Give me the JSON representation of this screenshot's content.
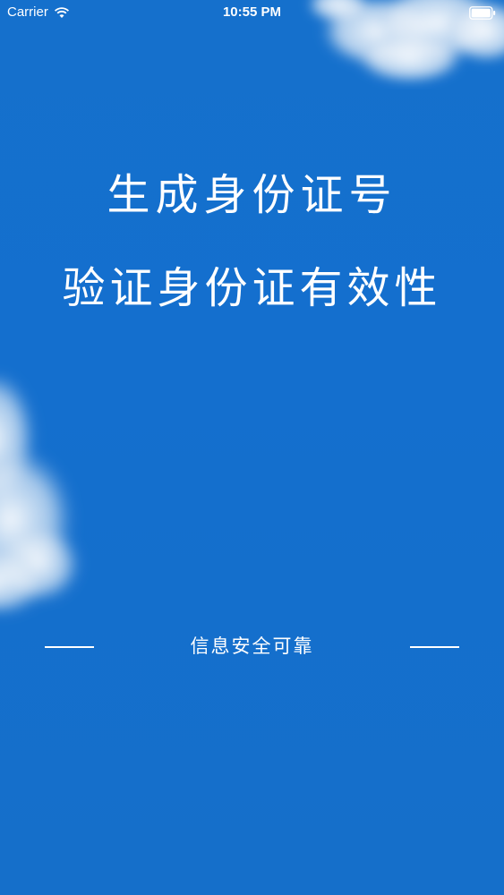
{
  "status_bar": {
    "carrier": "Carrier",
    "time": "10:55 PM"
  },
  "headline": {
    "line1": "生成身份证号",
    "line2": "验证身份证有效性"
  },
  "footer": {
    "tagline": "信息安全可靠"
  },
  "colors": {
    "background": "#146fce",
    "text": "#ffffff"
  }
}
